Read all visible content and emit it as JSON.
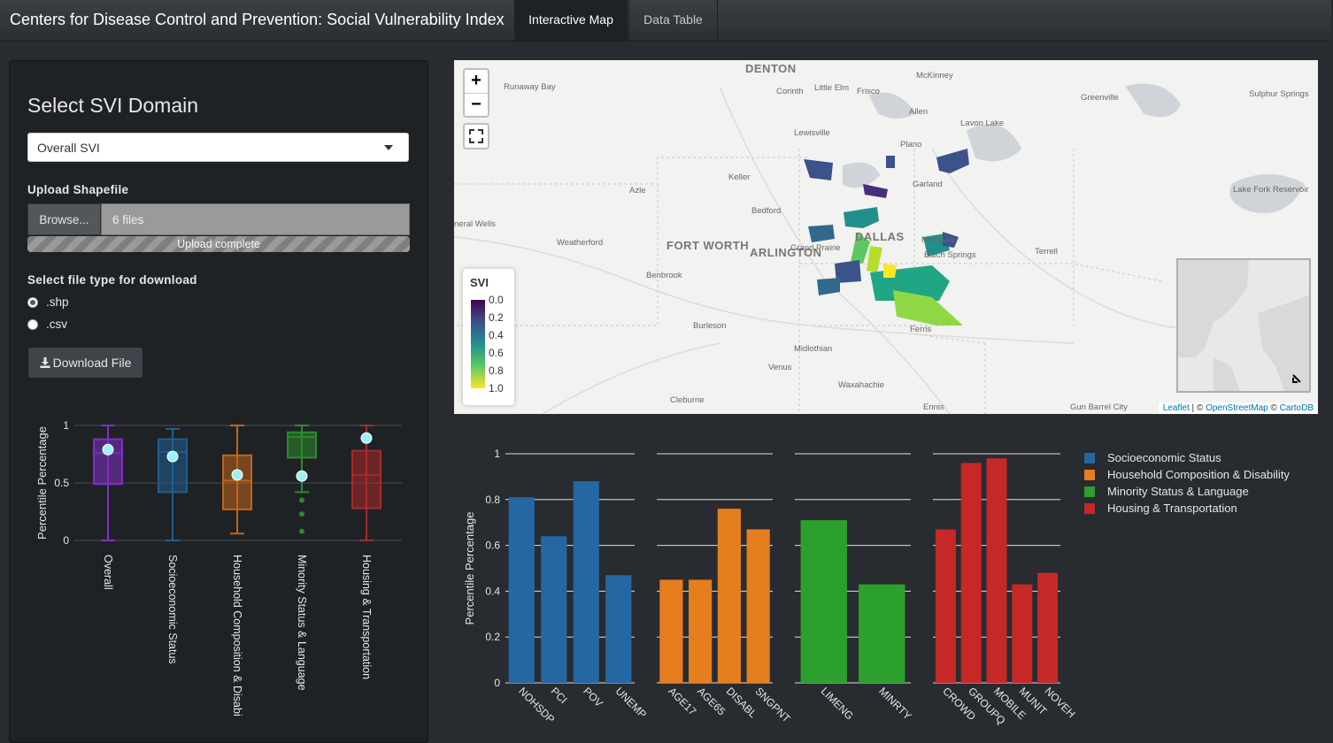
{
  "app": {
    "title": "Centers for Disease Control and Prevention: Social Vulnerability Index",
    "tabs": [
      {
        "label": "Interactive Map",
        "active": true
      },
      {
        "label": "Data Table",
        "active": false
      }
    ]
  },
  "sidebar": {
    "title": "Select SVI Domain",
    "domain_select": {
      "value": "Overall SVI"
    },
    "upload": {
      "label": "Upload Shapefile",
      "browse_label": "Browse...",
      "files_text": "6 files",
      "progress_text": "Upload complete"
    },
    "download": {
      "label": "Select file type for download",
      "options": [
        {
          "label": ".shp",
          "checked": true
        },
        {
          "label": ".csv",
          "checked": false
        }
      ],
      "button_label": "Download File",
      "button_icon": "download-icon"
    }
  },
  "map": {
    "zoom_in": "+",
    "zoom_out": "−",
    "legend": {
      "title": "SVI",
      "ticks": [
        "0.0",
        "0.2",
        "0.4",
        "0.6",
        "0.8",
        "1.0"
      ]
    },
    "places": [
      "DENTON",
      "McKinney",
      "Runaway Bay",
      "Corinth",
      "Little Elm",
      "Frisco",
      "Greenville",
      "Sulphur Springs",
      "Allen",
      "Lavon Lake",
      "Lewisville",
      "Plano",
      "Keller",
      "Garland",
      "Azle",
      "Lake Fork Reservoir",
      "Bedford",
      "Mineral Wells",
      "DALLAS",
      "Mesquite",
      "Weatherford",
      "FORT WORTH",
      "ARLINGTON",
      "Grand Prairie",
      "Balch Springs",
      "Terrell",
      "Benbrook",
      "Burleson",
      "Ferris",
      "Midlothian",
      "Venus",
      "Waxahachie",
      "Cleburne",
      "Ennis",
      "Gun Barrel City"
    ],
    "attribution": {
      "leaflet": "Leaflet",
      "sep1": " | © ",
      "osm": "OpenStreetMap",
      "sep2": " © ",
      "carto": "CartoDB"
    },
    "colors": {
      "viridis": [
        "#440154",
        "#3b528b",
        "#21908c",
        "#5dc863",
        "#fde725"
      ]
    }
  },
  "chart_data": [
    {
      "type": "box",
      "ylabel": "Percentile Percentage",
      "yticks": [
        "1",
        "0.5",
        "0"
      ],
      "ylim": [
        0,
        1
      ],
      "categories": [
        "Overall",
        "Socioeconomic Status",
        "Household Composition & Disabi",
        "Minority Status & Language",
        "Housing & Transportation"
      ],
      "colors": [
        "#7f2fc4",
        "#1f5f91",
        "#c0651b",
        "#2c8a2c",
        "#a82a2a"
      ],
      "boxes": [
        {
          "min": 0.0,
          "q1": 0.49,
          "median": 0.76,
          "q3": 0.88,
          "max": 1.0,
          "marker": 0.79,
          "outliers": []
        },
        {
          "min": 0.0,
          "q1": 0.42,
          "median": 0.77,
          "q3": 0.88,
          "max": 0.97,
          "marker": 0.73,
          "outliers": []
        },
        {
          "min": 0.06,
          "q1": 0.27,
          "median": 0.52,
          "q3": 0.74,
          "max": 1.0,
          "marker": 0.57,
          "outliers": []
        },
        {
          "min": 0.42,
          "q1": 0.72,
          "median": 0.9,
          "q3": 0.94,
          "max": 1.0,
          "marker": 0.56,
          "outliers": [
            0.35,
            0.23,
            0.08
          ]
        },
        {
          "min": 0.0,
          "q1": 0.28,
          "median": 0.57,
          "q3": 0.78,
          "max": 1.0,
          "marker": 0.89,
          "outliers": []
        }
      ]
    },
    {
      "type": "bar",
      "ylabel": "Percentile Percentage",
      "yticks": [
        "1",
        "0.8",
        "0.6",
        "0.4",
        "0.2",
        "0"
      ],
      "ylim": [
        0,
        1
      ],
      "groups": [
        {
          "name": "Socioeconomic Status",
          "color": "#2467a3",
          "categories": [
            "NOHSDP",
            "PCI",
            "POV",
            "UNEMP"
          ],
          "values": [
            0.81,
            0.64,
            0.88,
            0.47
          ]
        },
        {
          "name": "Household Composition & Disability",
          "color": "#e67e1d",
          "categories": [
            "AGE17",
            "AGE65",
            "DISABL",
            "SNGPNT"
          ],
          "values": [
            0.45,
            0.45,
            0.76,
            0.67
          ]
        },
        {
          "name": "Minority Status & Language",
          "color": "#2ca02c",
          "categories": [
            "LIMENG",
            "MINRTY"
          ],
          "values": [
            0.71,
            0.43
          ]
        },
        {
          "name": "Housing & Transportation",
          "color": "#c62828",
          "categories": [
            "CROWD",
            "GROUPQ",
            "MOBILE",
            "MUNIT",
            "NOVEH"
          ],
          "values": [
            0.67,
            0.96,
            0.98,
            0.43,
            0.48
          ]
        }
      ]
    }
  ]
}
